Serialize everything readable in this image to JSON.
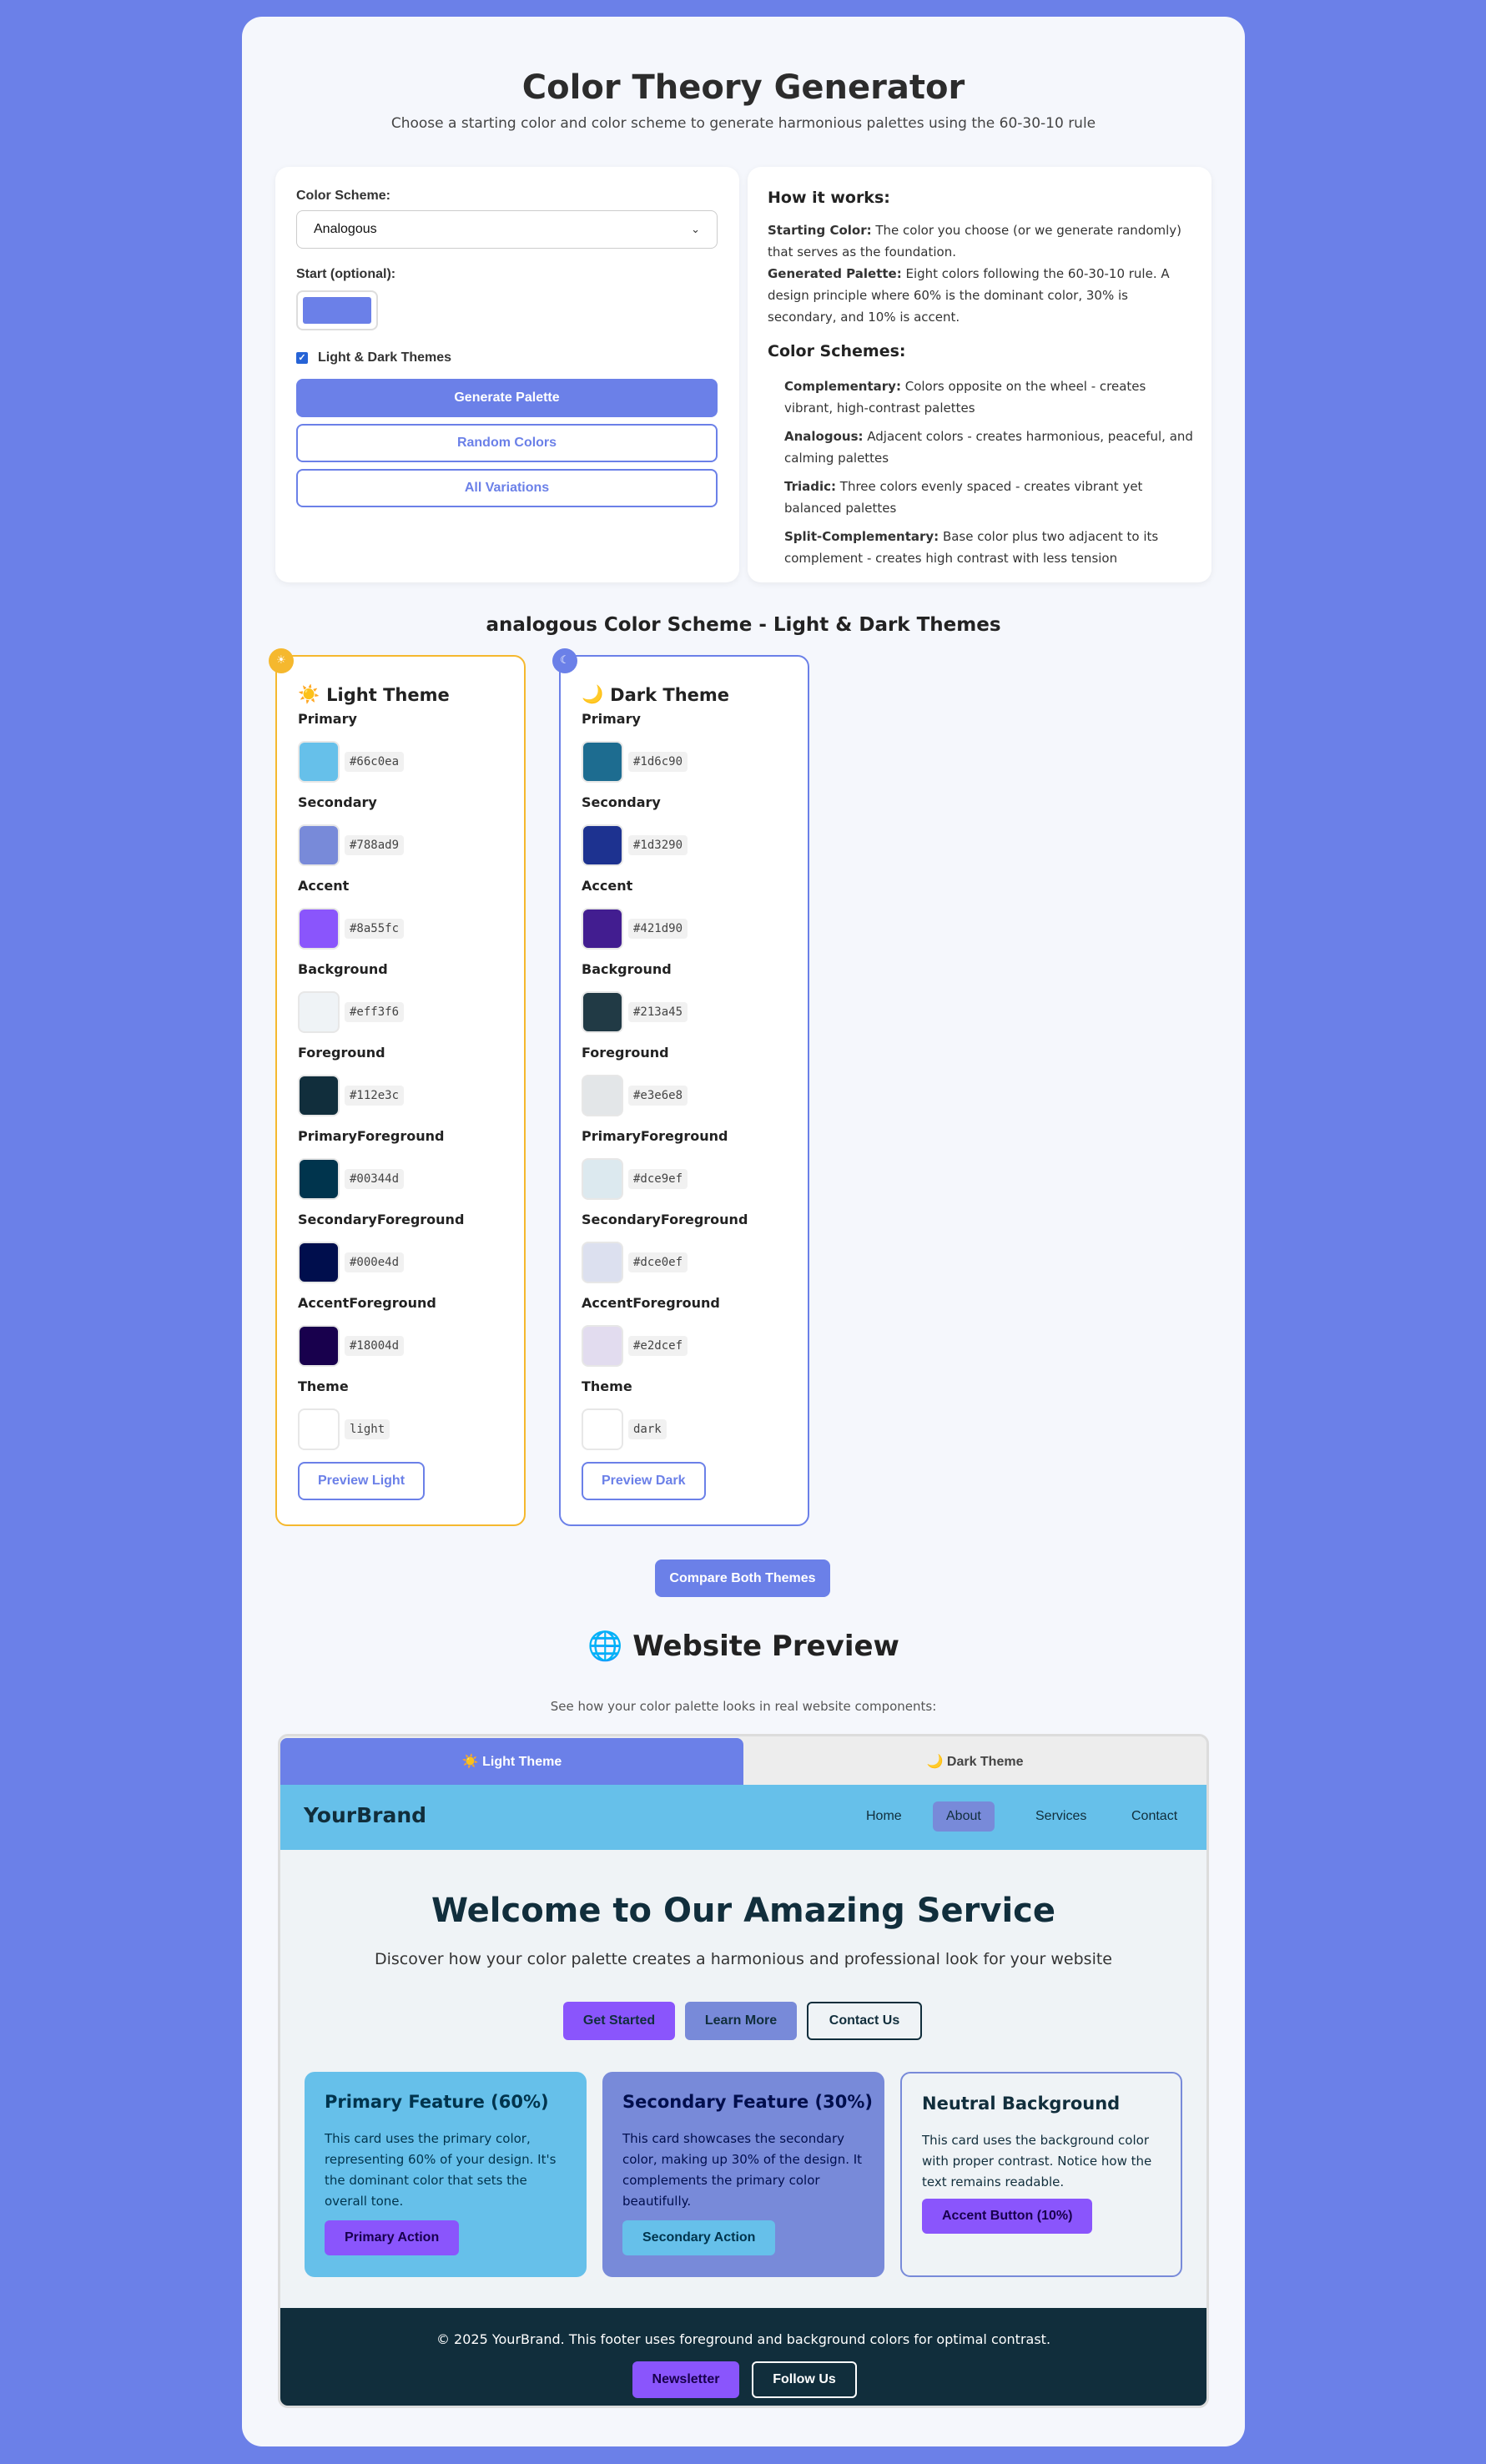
{
  "header": {
    "title": "Color Theory Generator",
    "subtitle": "Choose a starting color and color scheme to generate harmonious palettes using the 60-30-10 rule"
  },
  "controls": {
    "scheme_label": "Color Scheme:",
    "scheme_value": "Analogous",
    "start_label": "Start (optional):",
    "start_color": "#6b80e8",
    "themes_label": "Light & Dark Themes",
    "themes_checked": true,
    "generate_label": "Generate Palette",
    "random_label": "Random Colors",
    "variations_label": "All Variations"
  },
  "info": {
    "how_title": "How it works:",
    "starting_term": "Starting Color:",
    "starting_desc": " The color you choose (or we generate randomly) that serves as the foundation.",
    "generated_term": "Generated Palette:",
    "generated_desc": " Eight colors following the 60-30-10 rule. A design principle where 60% is the dominant color, 30% is secondary, and 10% is accent.",
    "schemes_title": "Color Schemes:",
    "schemes": [
      {
        "term": "Complementary:",
        "desc": " Colors opposite on the wheel - creates vibrant, high-contrast palettes"
      },
      {
        "term": "Analogous:",
        "desc": " Adjacent colors - creates harmonious, peaceful, and calming palettes"
      },
      {
        "term": "Triadic:",
        "desc": " Three colors evenly spaced - creates vibrant yet balanced palettes"
      },
      {
        "term": "Split-Complementary:",
        "desc": " Base color plus two adjacent to its complement - creates high contrast with less tension"
      }
    ]
  },
  "results_title": "analogous Color Scheme - Light & Dark Themes",
  "light_theme": {
    "badge": "☀",
    "icon": "☀️",
    "title": "Light Theme",
    "colors": [
      {
        "name": "Primary",
        "value": "#66c0ea"
      },
      {
        "name": "Secondary",
        "value": "#788ad9"
      },
      {
        "name": "Accent",
        "value": "#8a55fc"
      },
      {
        "name": "Background",
        "value": "#eff3f6"
      },
      {
        "name": "Foreground",
        "value": "#112e3c"
      },
      {
        "name": "PrimaryForeground",
        "value": "#00344d"
      },
      {
        "name": "SecondaryForeground",
        "value": "#000e4d"
      },
      {
        "name": "AccentForeground",
        "value": "#18004d"
      },
      {
        "name": "Theme",
        "value": "light"
      }
    ],
    "preview_label": "Preview Light"
  },
  "dark_theme": {
    "badge": "☾",
    "icon": "🌙",
    "title": "Dark Theme",
    "colors": [
      {
        "name": "Primary",
        "value": "#1d6c90"
      },
      {
        "name": "Secondary",
        "value": "#1d3290"
      },
      {
        "name": "Accent",
        "value": "#421d90"
      },
      {
        "name": "Background",
        "value": "#213a45"
      },
      {
        "name": "Foreground",
        "value": "#e3e6e8"
      },
      {
        "name": "PrimaryForeground",
        "value": "#dce9ef"
      },
      {
        "name": "SecondaryForeground",
        "value": "#dce0ef"
      },
      {
        "name": "AccentForeground",
        "value": "#e2dcef"
      },
      {
        "name": "Theme",
        "value": "dark"
      }
    ],
    "preview_label": "Preview Dark"
  },
  "compare_label": "Compare Both Themes",
  "website_preview": {
    "icon": "🌐",
    "title": "Website Preview",
    "subtitle": "See how your color palette looks in real website components:",
    "tab_light": "☀️ Light Theme",
    "tab_dark": "🌙 Dark Theme",
    "brand": "YourBrand",
    "nav": [
      "Home",
      "About",
      "Services",
      "Contact"
    ],
    "active_nav": "About",
    "hero_title": "Welcome to Our Amazing Service",
    "hero_subtitle": "Discover how your color palette creates a harmonious and professional look for your website",
    "hero_buttons": [
      "Get Started",
      "Learn More",
      "Contact Us"
    ],
    "cards": [
      {
        "title": "Primary Feature (60%)",
        "text": "This card uses the primary color, representing 60% of your design. It's the dominant color that sets the overall tone.",
        "button": "Primary Action"
      },
      {
        "title": "Secondary Feature (30%)",
        "text": "This card showcases the secondary color, making up 30% of the design. It complements the primary color beautifully.",
        "button": "Secondary Action"
      },
      {
        "title": "Neutral Background",
        "text": "This card uses the background color with proper contrast. Notice how the text remains readable.",
        "button": "Accent Button (10%)"
      }
    ],
    "footer_text": "© 2025 YourBrand. This footer uses foreground and background colors for optimal contrast.",
    "footer_buttons": [
      "Newsletter",
      "Follow Us"
    ]
  }
}
